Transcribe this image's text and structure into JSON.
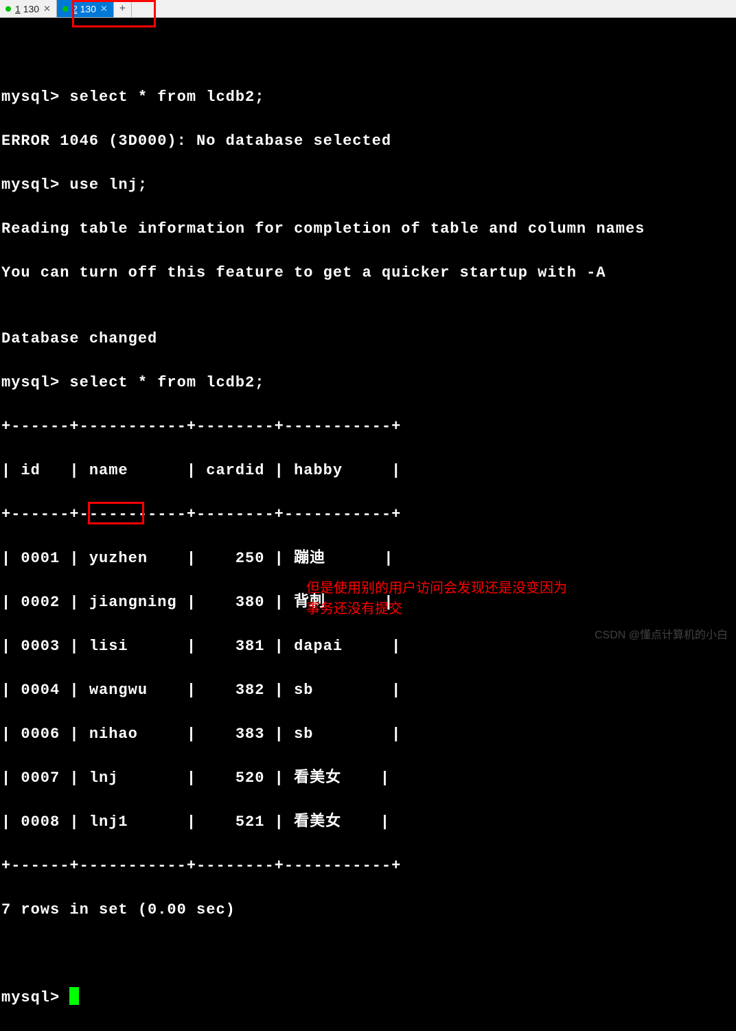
{
  "tabs": [
    {
      "index": "1",
      "label": "130"
    },
    {
      "index": "2",
      "label": "130"
    }
  ],
  "term": {
    "l1": "mysql> select * from lcdb2;",
    "l2": "ERROR 1046 (3D000): No database selected",
    "l3": "mysql> use lnj;",
    "l4": "Reading table information for completion of table and column names",
    "l5": "You can turn off this feature to get a quicker startup with -A",
    "l6": "",
    "l7": "Database changed",
    "l8": "mysql> select * from lcdb2;",
    "sep": "+------+-----------+--------+-----------+",
    "hdr": "| id   | name      | cardid | habby     |",
    "r1": "| 0001 | yuzhen    |    250 | 蹦迪      |",
    "r2": "| 0002 | jiangning |    380 | 背刺      |",
    "r3": "| 0003 | lisi      |    381 | dapai     |",
    "r4": "| 0004 | wangwu    |    382 | sb        |",
    "r5": "| 0006 | nihao     |    383 | sb        |",
    "r6": "| 0007 | lnj       |    520 | 看美女    |",
    "r7": "| 0008 | lnj1      |    521 | 看美女    |",
    "foot": "7 rows in set (0.00 sec)",
    "prompt": "mysql> "
  },
  "annotation": {
    "line1": "但是使用别的用户访问会发现还是没变因为",
    "line2": "事务还没有提交"
  },
  "watermark": "CSDN @懂点计算机的小白",
  "table": {
    "columns": [
      "id",
      "name",
      "cardid",
      "habby"
    ],
    "rows": [
      {
        "id": "0001",
        "name": "yuzhen",
        "cardid": 250,
        "habby": "蹦迪"
      },
      {
        "id": "0002",
        "name": "jiangning",
        "cardid": 380,
        "habby": "背刺"
      },
      {
        "id": "0003",
        "name": "lisi",
        "cardid": 381,
        "habby": "dapai"
      },
      {
        "id": "0004",
        "name": "wangwu",
        "cardid": 382,
        "habby": "sb"
      },
      {
        "id": "0006",
        "name": "nihao",
        "cardid": 383,
        "habby": "sb"
      },
      {
        "id": "0007",
        "name": "lnj",
        "cardid": 520,
        "habby": "看美女"
      },
      {
        "id": "0008",
        "name": "lnj1",
        "cardid": 521,
        "habby": "看美女"
      }
    ],
    "summary": "7 rows in set (0.00 sec)"
  }
}
